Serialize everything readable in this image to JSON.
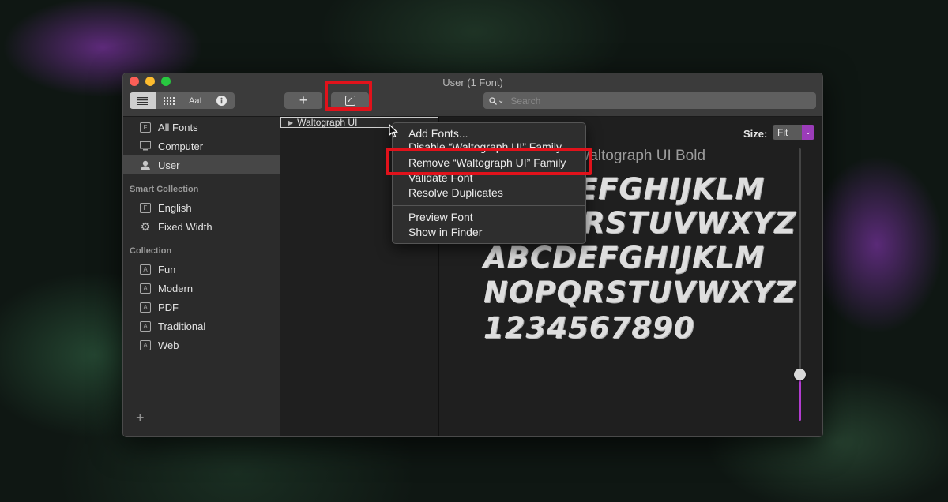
{
  "window": {
    "title": "User (1 Font)"
  },
  "toolbar": {
    "view_buttons": [
      {
        "icon": "list-icon"
      },
      {
        "icon": "grid-icon"
      },
      {
        "label": "AaI",
        "icon": "sample-icon"
      },
      {
        "icon": "info-icon"
      }
    ],
    "add_label": "+",
    "check_icon": "checkbox-icon",
    "search_placeholder": "Search"
  },
  "sidebar": {
    "library_items": [
      {
        "label": "All Fonts",
        "icon": "font-book-icon",
        "selected": false
      },
      {
        "label": "Computer",
        "icon": "computer-icon",
        "selected": false
      },
      {
        "label": "User",
        "icon": "user-icon",
        "selected": true
      }
    ],
    "smart_header": "Smart Collection",
    "smart_items": [
      {
        "label": "English",
        "icon": "font-book-icon"
      },
      {
        "label": "Fixed Width",
        "icon": "gear-icon"
      }
    ],
    "collection_header": "Collection",
    "collection_items": [
      {
        "label": "Fun",
        "icon": "collection-icon"
      },
      {
        "label": "Modern",
        "icon": "collection-icon"
      },
      {
        "label": "PDF",
        "icon": "collection-icon"
      },
      {
        "label": "Traditional",
        "icon": "collection-icon"
      },
      {
        "label": "Web",
        "icon": "collection-icon"
      }
    ],
    "add_collection_label": "+"
  },
  "fontlist": {
    "selected_family": "Waltograph UI"
  },
  "preview": {
    "size_label": "Size:",
    "size_value": "Fit",
    "font_title": "Waltograph UI Bold",
    "lines": [
      "ABCDEFGHIJKLM",
      "NOPQRSTUVWXYZ",
      "ABCDEFGHIJKLM",
      "NOPQRSTUVWXYZ",
      "1234567890"
    ],
    "slider_level": 0.17
  },
  "context_menu": {
    "items": [
      "Add Fonts...",
      "Disable “Waltograph UI” Family",
      "Remove “Waltograph UI” Family",
      "Validate Font",
      "Resolve Duplicates",
      "Preview Font",
      "Show in Finder"
    ]
  },
  "colors": {
    "annotation": "#e1121b",
    "accent": "#b23cd0"
  }
}
